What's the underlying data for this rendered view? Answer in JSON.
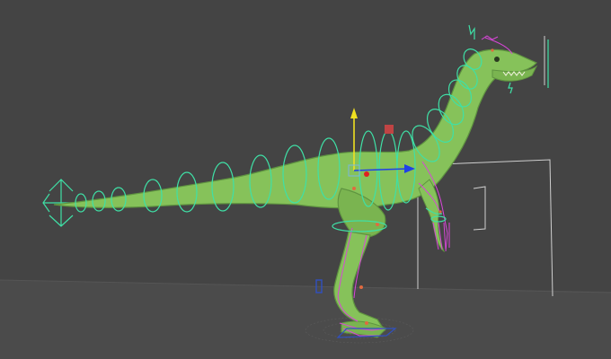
{
  "viewport": {
    "background": "#444444",
    "floor_color": "#4e4e4e",
    "grid_color": "#5a5a5a"
  },
  "colors": {
    "mesh": "#86c25a",
    "mesh_shade": "#5f9440",
    "control_curves": "#3fe0a6",
    "deform_rig": "#d846d8",
    "joint_orange": "#e06a40",
    "manip_y": "#f0e020",
    "manip_x": "#2040e8",
    "manip_center": "#e02020",
    "manip_red_square": "#c04444",
    "backdrop_line": "#d8d8d8"
  },
  "scene": {
    "model": "raptor-mesh",
    "tool": "move-manipulator"
  }
}
